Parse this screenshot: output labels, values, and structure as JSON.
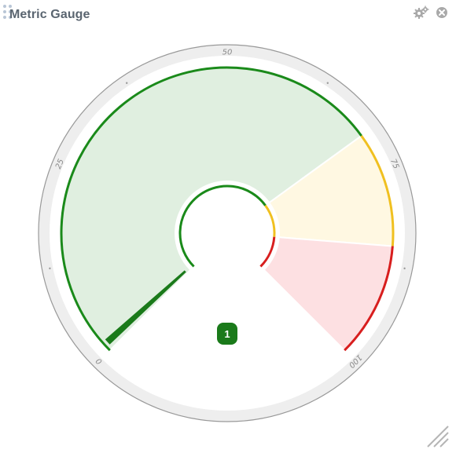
{
  "widget": {
    "title": "Metric Gauge",
    "icons": {
      "settings": "gears-icon",
      "close": "close-circle-icon",
      "drag": "drag-handle-icon",
      "resize": "resize-grip-icon"
    }
  },
  "gauge": {
    "min": 0,
    "max": 100,
    "value": 1,
    "value_label": "1",
    "tick_labels": [
      "0",
      "25",
      "50",
      "75",
      "100"
    ],
    "ranges": [
      {
        "from": 0,
        "to": 70,
        "color": "#1a8a1a",
        "fill": "#e0efe0"
      },
      {
        "from": 70,
        "to": 85,
        "color": "#f0c020",
        "fill": "#fff8e2"
      },
      {
        "from": 85,
        "to": 100,
        "color": "#d81e1e",
        "fill": "#fde0e2"
      }
    ],
    "colors": {
      "needle": "#1a7a1a",
      "badge": "#1a7a1a",
      "dial_ring": "#e8e8e8",
      "dial_border": "#9a9a9a"
    }
  }
}
